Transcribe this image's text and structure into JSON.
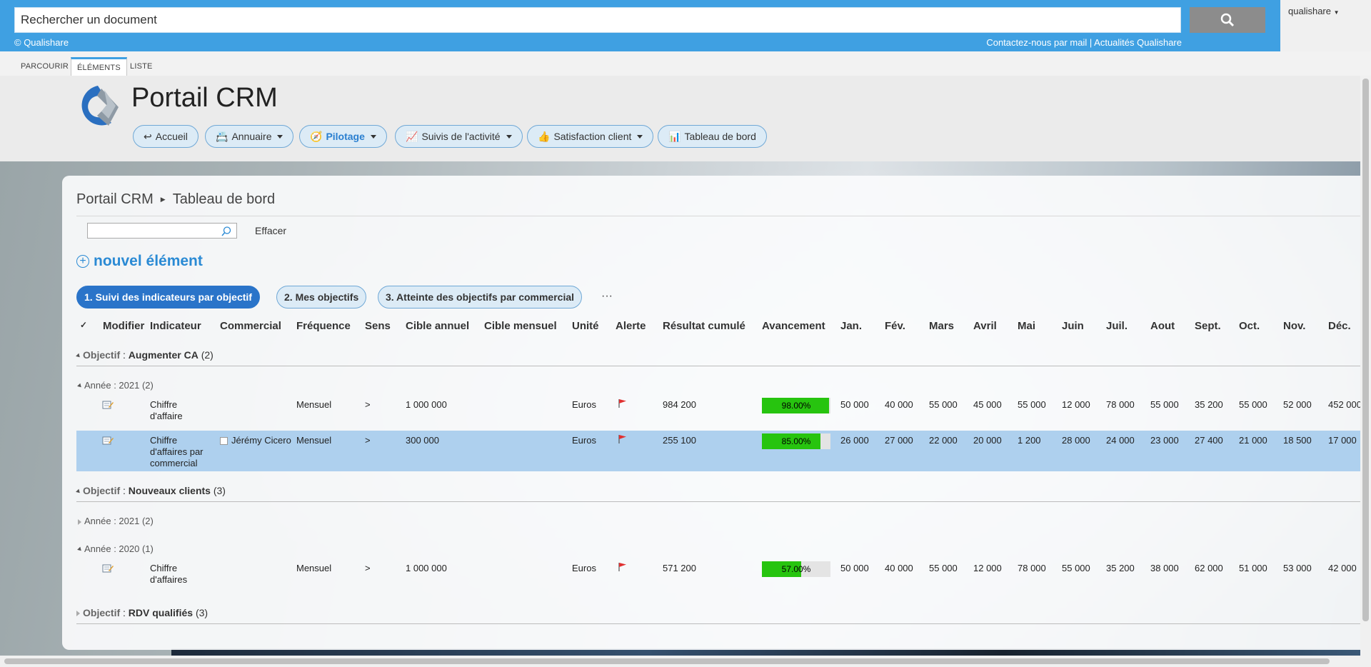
{
  "topbar": {
    "search_placeholder": "Rechercher un document",
    "copyright": "© Qualishare",
    "link_contact": "Contactez-nous par mail",
    "link_separator": "|",
    "link_news": "Actualités Qualishare",
    "user": "qualishare"
  },
  "ribbon": {
    "tabs": [
      "PARCOURIR",
      "ÉLÉMENTS",
      "LISTE"
    ],
    "active": "ÉLÉMENTS"
  },
  "site": {
    "title": "Portail CRM",
    "nav": [
      {
        "icon": "↩",
        "label": "Accueil",
        "dropdown": false
      },
      {
        "icon": "📇",
        "label": "Annuaire",
        "dropdown": true
      },
      {
        "icon": "🧭",
        "label": "Pilotage",
        "dropdown": true,
        "active": true
      },
      {
        "icon": "📈",
        "label": "Suivis de l'activité",
        "dropdown": true
      },
      {
        "icon": "👍",
        "label": "Satisfaction client",
        "dropdown": true
      },
      {
        "icon": "📊",
        "label": "Tableau de bord",
        "dropdown": false
      }
    ]
  },
  "page": {
    "breadcrumb_root": "Portail CRM",
    "breadcrumb_current": "Tableau de bord",
    "clear_label": "Effacer",
    "new_item": "nouvel élément",
    "views": [
      "1. Suivi des indicateurs par objectif",
      "2. Mes objectifs",
      "3. Atteinte des objectifs par commercial"
    ],
    "more": "···"
  },
  "table": {
    "columns": [
      "✓",
      "Modifier",
      "Indicateur",
      "Commercial",
      "Fréquence",
      "Sens",
      "Cible annuel",
      "Cible mensuel",
      "Unité",
      "Alerte",
      "Résultat cumulé",
      "Avancement",
      "Jan.",
      "Fév.",
      "Mars",
      "Avril",
      "Mai",
      "Juin",
      "Juil.",
      "Aout",
      "Sept.",
      "Oct.",
      "Nov.",
      "Déc."
    ],
    "groups": [
      {
        "label": "Objectif",
        "value": "Augmenter CA",
        "count": "(2)"
      },
      {
        "label": "Objectif",
        "value": "Nouveaux clients",
        "count": "(3)"
      },
      {
        "label": "Objectif",
        "value": "RDV qualifiés",
        "count": "(3)"
      }
    ],
    "subgroups": [
      "Année : 2021 (2)",
      "Année : 2021 (2)",
      "Année : 2020 (1)"
    ],
    "rows": [
      {
        "indicateur": [
          "Chiffre",
          "d'affaire"
        ],
        "commercial": "",
        "frequence": "Mensuel",
        "sens": ">",
        "cible_annuel": "1 000 000",
        "cible_mensuel": "",
        "unite": "Euros",
        "resultat": "984 200",
        "avancement": "98.00%",
        "progress": 0.98,
        "months": [
          "50 000",
          "40 000",
          "55 000",
          "45 000",
          "55 000",
          "12 000",
          "78 000",
          "55 000",
          "35 200",
          "55 000",
          "52 000",
          "452 000"
        ]
      },
      {
        "indicateur": [
          "Chiffre",
          "d'affaires par",
          "commercial"
        ],
        "commercial": "Jérémy Cicero",
        "frequence": "Mensuel",
        "sens": ">",
        "cible_annuel": "300 000",
        "cible_mensuel": "",
        "unite": "Euros",
        "resultat": "255 100",
        "avancement": "85.00%",
        "progress": 0.85,
        "months": [
          "26 000",
          "27 000",
          "22 000",
          "20 000",
          "1 200",
          "28 000",
          "24 000",
          "23 000",
          "27 400",
          "21 000",
          "18 500",
          "17 000"
        ]
      },
      {
        "indicateur": [
          "Chiffre",
          "d'affaires"
        ],
        "commercial": "",
        "frequence": "Mensuel",
        "sens": ">",
        "cible_annuel": "1 000 000",
        "cible_mensuel": "",
        "unite": "Euros",
        "resultat": "571 200",
        "avancement": "57.00%",
        "progress": 0.57,
        "months": [
          "50 000",
          "40 000",
          "55 000",
          "12 000",
          "78 000",
          "55 000",
          "35 200",
          "38 000",
          "62 000",
          "51 000",
          "53 000",
          "42 000"
        ]
      }
    ]
  },
  "colors": {
    "accent": "#3fa0e2",
    "selected_row": "#aed0ee",
    "progress": "#27c40f",
    "active_view": "#2a74c9"
  }
}
